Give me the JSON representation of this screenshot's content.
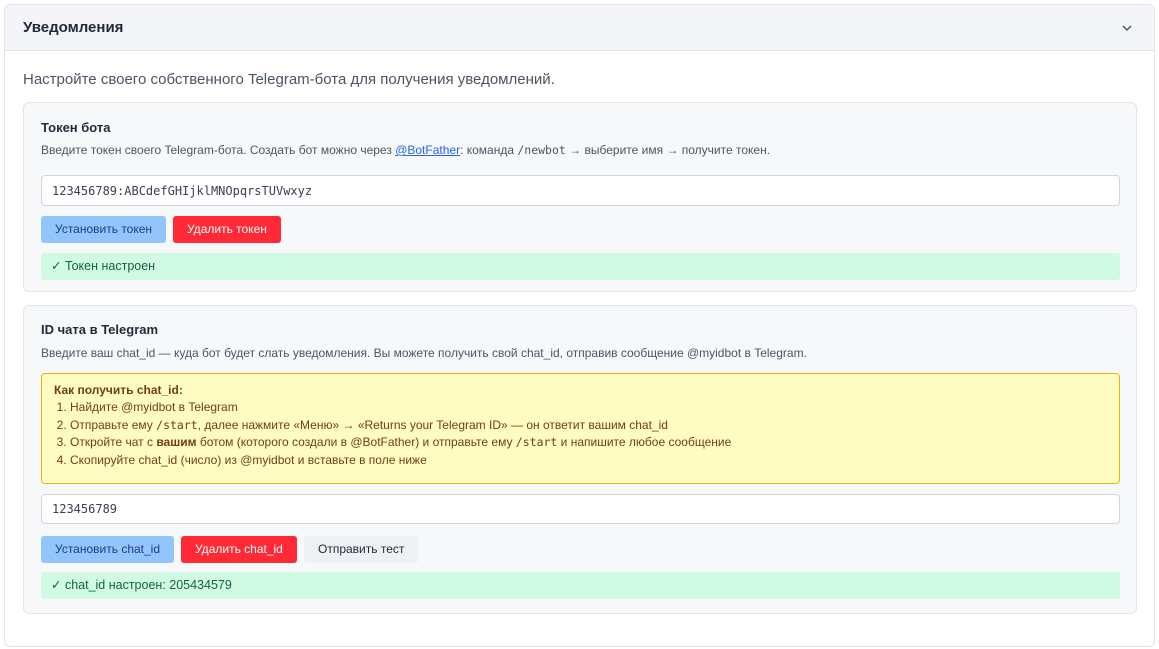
{
  "header": {
    "title": "Уведомления",
    "toggle_icon": "chevron-down-icon"
  },
  "intro": "Настройте своего собственного Telegram-бота для получения уведомлений.",
  "token": {
    "title": "Токен бота",
    "desc_prefix": "Введите токен своего Telegram-бота. Создать бот можно через ",
    "link": "@BotFather",
    "desc_mid": ": команда ",
    "desc_cmd": "/newbot",
    "desc_suffix": " → выберите имя → получите токен.",
    "input_value": "123456789:ABCdefGHIjklMNOpqrsTUVwxyz",
    "set_label": "Установить токен",
    "delete_label": "Удалить токен",
    "status": "✓ Токен настроен"
  },
  "chat": {
    "title": "ID чата в Telegram",
    "desc": "Введите ваш chat_id — куда бот будет слать уведомления. Вы можете получить свой chat_id, отправив сообщение @myidbot в Telegram.",
    "hint_title": "Как получить chat_id:",
    "step1": "Найдите @myidbot в Telegram",
    "step2_a": "Отправьте ему ",
    "step2_code": "/start",
    "step2_b": ", далее нажмите «Меню» → «Returns your Telegram ID» — он ответит вашим chat_id",
    "step3_a": "Откройте чат с ",
    "step3_bold": "вашим",
    "step3_b": " ботом (которого создали в @BotFather) и отправьте ему ",
    "step3_code": "/start",
    "step3_c": " и напишите любое сообщение",
    "step4": "Скопируйте chat_id (число) из @myidbot и вставьте в поле ниже",
    "input_value": "123456789",
    "set_label": "Установить chat_id",
    "delete_label": "Удалить chat_id",
    "test_label": "Отправить тест",
    "status": "✓ chat_id настроен: 205434579"
  },
  "colors": {
    "primary_button": "#93c5fd",
    "danger_button": "#ff2a35",
    "success_bg": "#d1fae5",
    "hint_bg": "#fefbc3",
    "link": "#2563eb"
  }
}
